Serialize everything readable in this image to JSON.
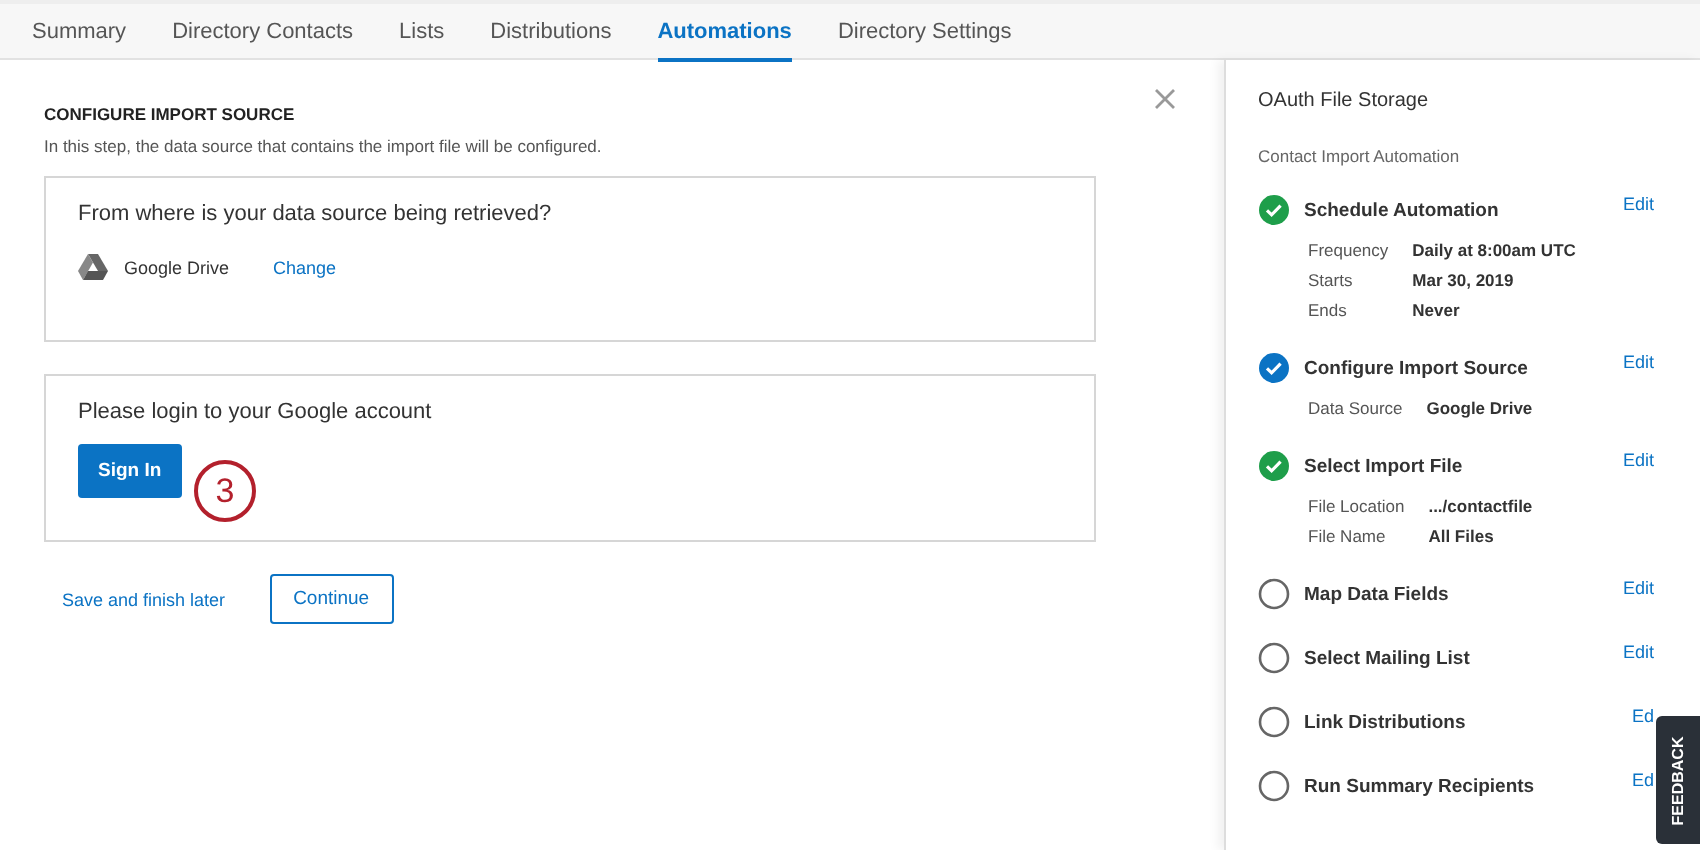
{
  "tabs": [
    {
      "label": "Summary",
      "selected": false
    },
    {
      "label": "Directory Contacts",
      "selected": false
    },
    {
      "label": "Lists",
      "selected": false
    },
    {
      "label": "Distributions",
      "selected": false
    },
    {
      "label": "Automations",
      "selected": true
    },
    {
      "label": "Directory Settings",
      "selected": false
    }
  ],
  "main": {
    "heading": "CONFIGURE IMPORT SOURCE",
    "description": "In this step, the data source that contains the import file will be configured.",
    "source_card": {
      "question": "From where is your data source being retrieved?",
      "source": "Google Drive",
      "change_link": "Change"
    },
    "login_card": {
      "prompt": "Please login to your Google account",
      "button": "Sign In",
      "callout": "3"
    },
    "save_link": "Save and finish later",
    "continue_button": "Continue"
  },
  "sidebar": {
    "title": "OAuth File Storage",
    "subtitle": "Contact Import Automation",
    "steps": [
      {
        "title": "Schedule Automation",
        "completed": true,
        "active": false,
        "edit": "Edit",
        "details": [
          {
            "label": "Frequency",
            "value": "Daily at 8:00am UTC"
          },
          {
            "label": "Starts",
            "value": "Mar 30, 2019"
          },
          {
            "label": "Ends",
            "value": "Never"
          }
        ]
      },
      {
        "title": "Configure Import Source",
        "completed": true,
        "active": true,
        "edit": "Edit",
        "details": [
          {
            "label": "Data Source",
            "value": "Google Drive"
          }
        ]
      },
      {
        "title": "Select Import File",
        "completed": true,
        "active": false,
        "edit": "Edit",
        "details": [
          {
            "label": "File Location",
            "value": ".../contactfile"
          },
          {
            "label": "File Name",
            "value": "All Files"
          }
        ]
      },
      {
        "title": "Map Data Fields",
        "completed": false,
        "active": false,
        "edit": "Edit"
      },
      {
        "title": "Select Mailing List",
        "completed": false,
        "active": false,
        "edit": "Edit"
      },
      {
        "title": "Link Distributions",
        "completed": false,
        "active": false,
        "edit": "Ed"
      },
      {
        "title": "Run Summary Recipients",
        "completed": false,
        "active": false,
        "edit": "Ed"
      }
    ]
  },
  "feedback_tab": "FEEDBACK"
}
